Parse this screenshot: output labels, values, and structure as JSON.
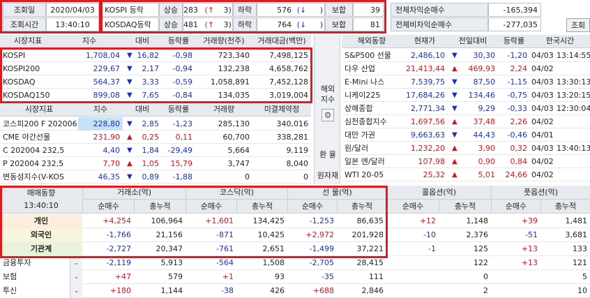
{
  "top": {
    "query_date_label": "조회일",
    "query_date": "2020/04/03",
    "query_time_label": "조회시간",
    "query_time": "13:40:10",
    "kospi_label": "KOSPI 등락",
    "kosdaq_label": "KOSDAQ등락",
    "rise_label": "상승",
    "fall_label": "하락",
    "flat_label": "보합",
    "kospi": {
      "rise": "283",
      "rise_arrow": "(↑",
      "rise_limit": "3)",
      "fall": "576",
      "fall_arrow": "(↓",
      "fall_limit": ")",
      "flat": "39"
    },
    "kosdaq": {
      "rise": "481",
      "rise_arrow": "(↑",
      "rise_limit": "3)",
      "fall": "764",
      "fall_arrow": "(↓",
      "fall_limit": ")",
      "flat": "81"
    },
    "diff_label": "전체차익순매수",
    "diff_value": "-165,394",
    "nondiff_label": "전체비차익순매수",
    "nondiff_value": "-277,035",
    "refresh_button": "조회"
  },
  "index_table": {
    "headers": [
      "시장지표",
      "지수",
      "대비",
      "등락률",
      "거래량(천주)",
      "거래대금(백만)"
    ],
    "rows": [
      {
        "name": "KOSPI",
        "index": "1,708,04",
        "dir": "▼",
        "change": "16,82",
        "rate": "-0,98",
        "volume": "723,340",
        "amount": "7,498,125"
      },
      {
        "name": "KOSPI200",
        "index": "229,67",
        "dir": "▼",
        "change": "2,17",
        "rate": "-0,94",
        "volume": "132,238",
        "amount": "4,658,762"
      },
      {
        "name": "KOSDAQ",
        "index": "564,37",
        "dir": "▼",
        "change": "3,33",
        "rate": "-0,59",
        "volume": "1,058,891",
        "amount": "7,452,128"
      },
      {
        "name": "KOSDAQ150",
        "index": "899,08",
        "dir": "▼",
        "change": "7,65",
        "rate": "-0,84",
        "volume": "134,035",
        "amount": "3,019,004"
      }
    ]
  },
  "deriv_table": {
    "headers": [
      "시장지표",
      "지수",
      "대비",
      "등락률",
      "거래량",
      "미결제약정"
    ],
    "rows": [
      {
        "name": "코스피200 F 202006",
        "index": "228,80",
        "dir": "▼",
        "change": "2,85",
        "rate": "-1,23",
        "volume": "285,130",
        "oi": "340,016",
        "color": "blue",
        "sel": true
      },
      {
        "name": "CME 야간선물",
        "index": "231,90",
        "dir": "▲",
        "change": "0,25",
        "rate": "0,11",
        "volume": "60,700",
        "oi": "338,281",
        "color": "red",
        "sel": false
      },
      {
        "name": "C 202004 232,5",
        "index": "4,40",
        "dir": "▼",
        "change": "1,84",
        "rate": "-29,49",
        "volume": "5,664",
        "oi": "9,119",
        "color": "blue",
        "sel": false
      },
      {
        "name": "P 202004 232,5",
        "index": "7,70",
        "dir": "▲",
        "change": "1,05",
        "rate": "15,79",
        "volume": "3,747",
        "oi": "8,040",
        "color": "red",
        "sel": false
      },
      {
        "name": "변동성지수(V-KOS",
        "index": "46,35",
        "dir": "▼",
        "change": "0,89",
        "rate": "-1,88",
        "volume": "0",
        "oi": "0",
        "color": "blue",
        "sel": false
      }
    ]
  },
  "side_buttons": {
    "overseas_index": "해외\n지수",
    "exchange": "환 율",
    "commodity": "원자재",
    "gear": "gear-icon"
  },
  "overseas_table": {
    "headers": [
      "해외동향",
      "현재가",
      "전일대비",
      "등락률",
      "한국시간"
    ],
    "rows": [
      {
        "name": "S&P500 선물",
        "price": "2,486,10",
        "dir": "▼",
        "change": "30,30",
        "rate": "-1,20",
        "date": "04/03",
        "time": "13:14:55",
        "color": "blue"
      },
      {
        "name": "다우 산업",
        "price": "21,413,44",
        "dir": "▲",
        "change": "469,93",
        "rate": "2,24",
        "date": "04/02",
        "time": "",
        "color": "red"
      },
      {
        "name": "E-Mini 나스",
        "price": "7,539,75",
        "dir": "▼",
        "change": "87,50",
        "rate": "-1,15",
        "date": "04/03",
        "time": "13:30:13",
        "color": "blue"
      },
      {
        "name": "니케이225",
        "price": "17,684,26",
        "dir": "▼",
        "change": "134,46",
        "rate": "-0,75",
        "date": "04/03",
        "time": "13:20:15",
        "color": "blue"
      },
      {
        "name": "상해종합",
        "price": "2,771,34",
        "dir": "▼",
        "change": "9,29",
        "rate": "-0,33",
        "date": "04/03",
        "time": "12:30:04",
        "color": "blue"
      },
      {
        "name": "심천종합지수",
        "price": "1,697,56",
        "dir": "▲",
        "change": "37,48",
        "rate": "2,26",
        "date": "04/02",
        "time": "",
        "color": "red"
      },
      {
        "name": "대만 가권",
        "price": "9,663,63",
        "dir": "▼",
        "change": "44,43",
        "rate": "-0,46",
        "date": "04/01",
        "time": "",
        "color": "blue"
      },
      {
        "name": "원/달러",
        "price": "1,232,20",
        "dir": "▲",
        "change": "3,90",
        "rate": "0,32",
        "date": "04/03",
        "time": "13:40:13",
        "color": "red"
      },
      {
        "name": "일본 엔/달러",
        "price": "107,98",
        "dir": "▲",
        "change": "0,90",
        "rate": "0,84",
        "date": "04/02",
        "time": "",
        "color": "red"
      },
      {
        "name": "WTI 20-05",
        "price": "25,32",
        "dir": "▲",
        "change": "5,01",
        "rate": "24,66",
        "date": "04/02",
        "time": "",
        "color": "red"
      }
    ]
  },
  "trading": {
    "title": "매매동향",
    "time": "13:40:10",
    "groups": [
      "거래소(억)",
      "코스닥(억)",
      "선 물(억)",
      "콜옵션(억)",
      "풋옵션(억)"
    ],
    "sub_net": "순매수",
    "sub_cum": "총누적",
    "rows": [
      {
        "name": "개인",
        "vals": [
          "+4,254",
          "106,964",
          "+1,601",
          "134,425",
          "-1,253",
          "86,635",
          "+12",
          "1,148",
          "+39",
          "1,481"
        ],
        "bold": true,
        "bg": "#fbeedd"
      },
      {
        "name": "외국인",
        "vals": [
          "-1,766",
          "21,156",
          "-871",
          "10,425",
          "+2,972",
          "201,928",
          "-10",
          "2,376",
          "-51",
          "3,681"
        ],
        "bold": true,
        "bg": "#f7f6dc"
      },
      {
        "name": "기관계",
        "vals": [
          "-2,727",
          "20,347",
          "-761",
          "2,651",
          "-1,499",
          "37,221",
          "-1",
          "125",
          "+13",
          "133"
        ],
        "bold": true,
        "bg": "#e9f3dc"
      },
      {
        "name": "금융투자",
        "vals": [
          "-2,119",
          "5,913",
          "-564",
          "1,508",
          "-2,705",
          "28,415",
          "",
          "122",
          "+13",
          "121"
        ],
        "bold": false,
        "bg": "#ffffff"
      },
      {
        "name": "보험",
        "vals": [
          "+47",
          "579",
          "+1",
          "93",
          "-35",
          "111",
          "",
          "0",
          "",
          "5"
        ],
        "bold": false,
        "bg": "#ffffff"
      },
      {
        "name": "투신",
        "vals": [
          "+180",
          "1,144",
          "-38",
          "426",
          "+688",
          "2,846",
          "",
          "2",
          "",
          "10"
        ],
        "bold": false,
        "bg": "#ffffff"
      }
    ]
  },
  "colors": {
    "up": "#d4141c",
    "down": "#1b2fb8",
    "highlight": "#e01a1f"
  }
}
